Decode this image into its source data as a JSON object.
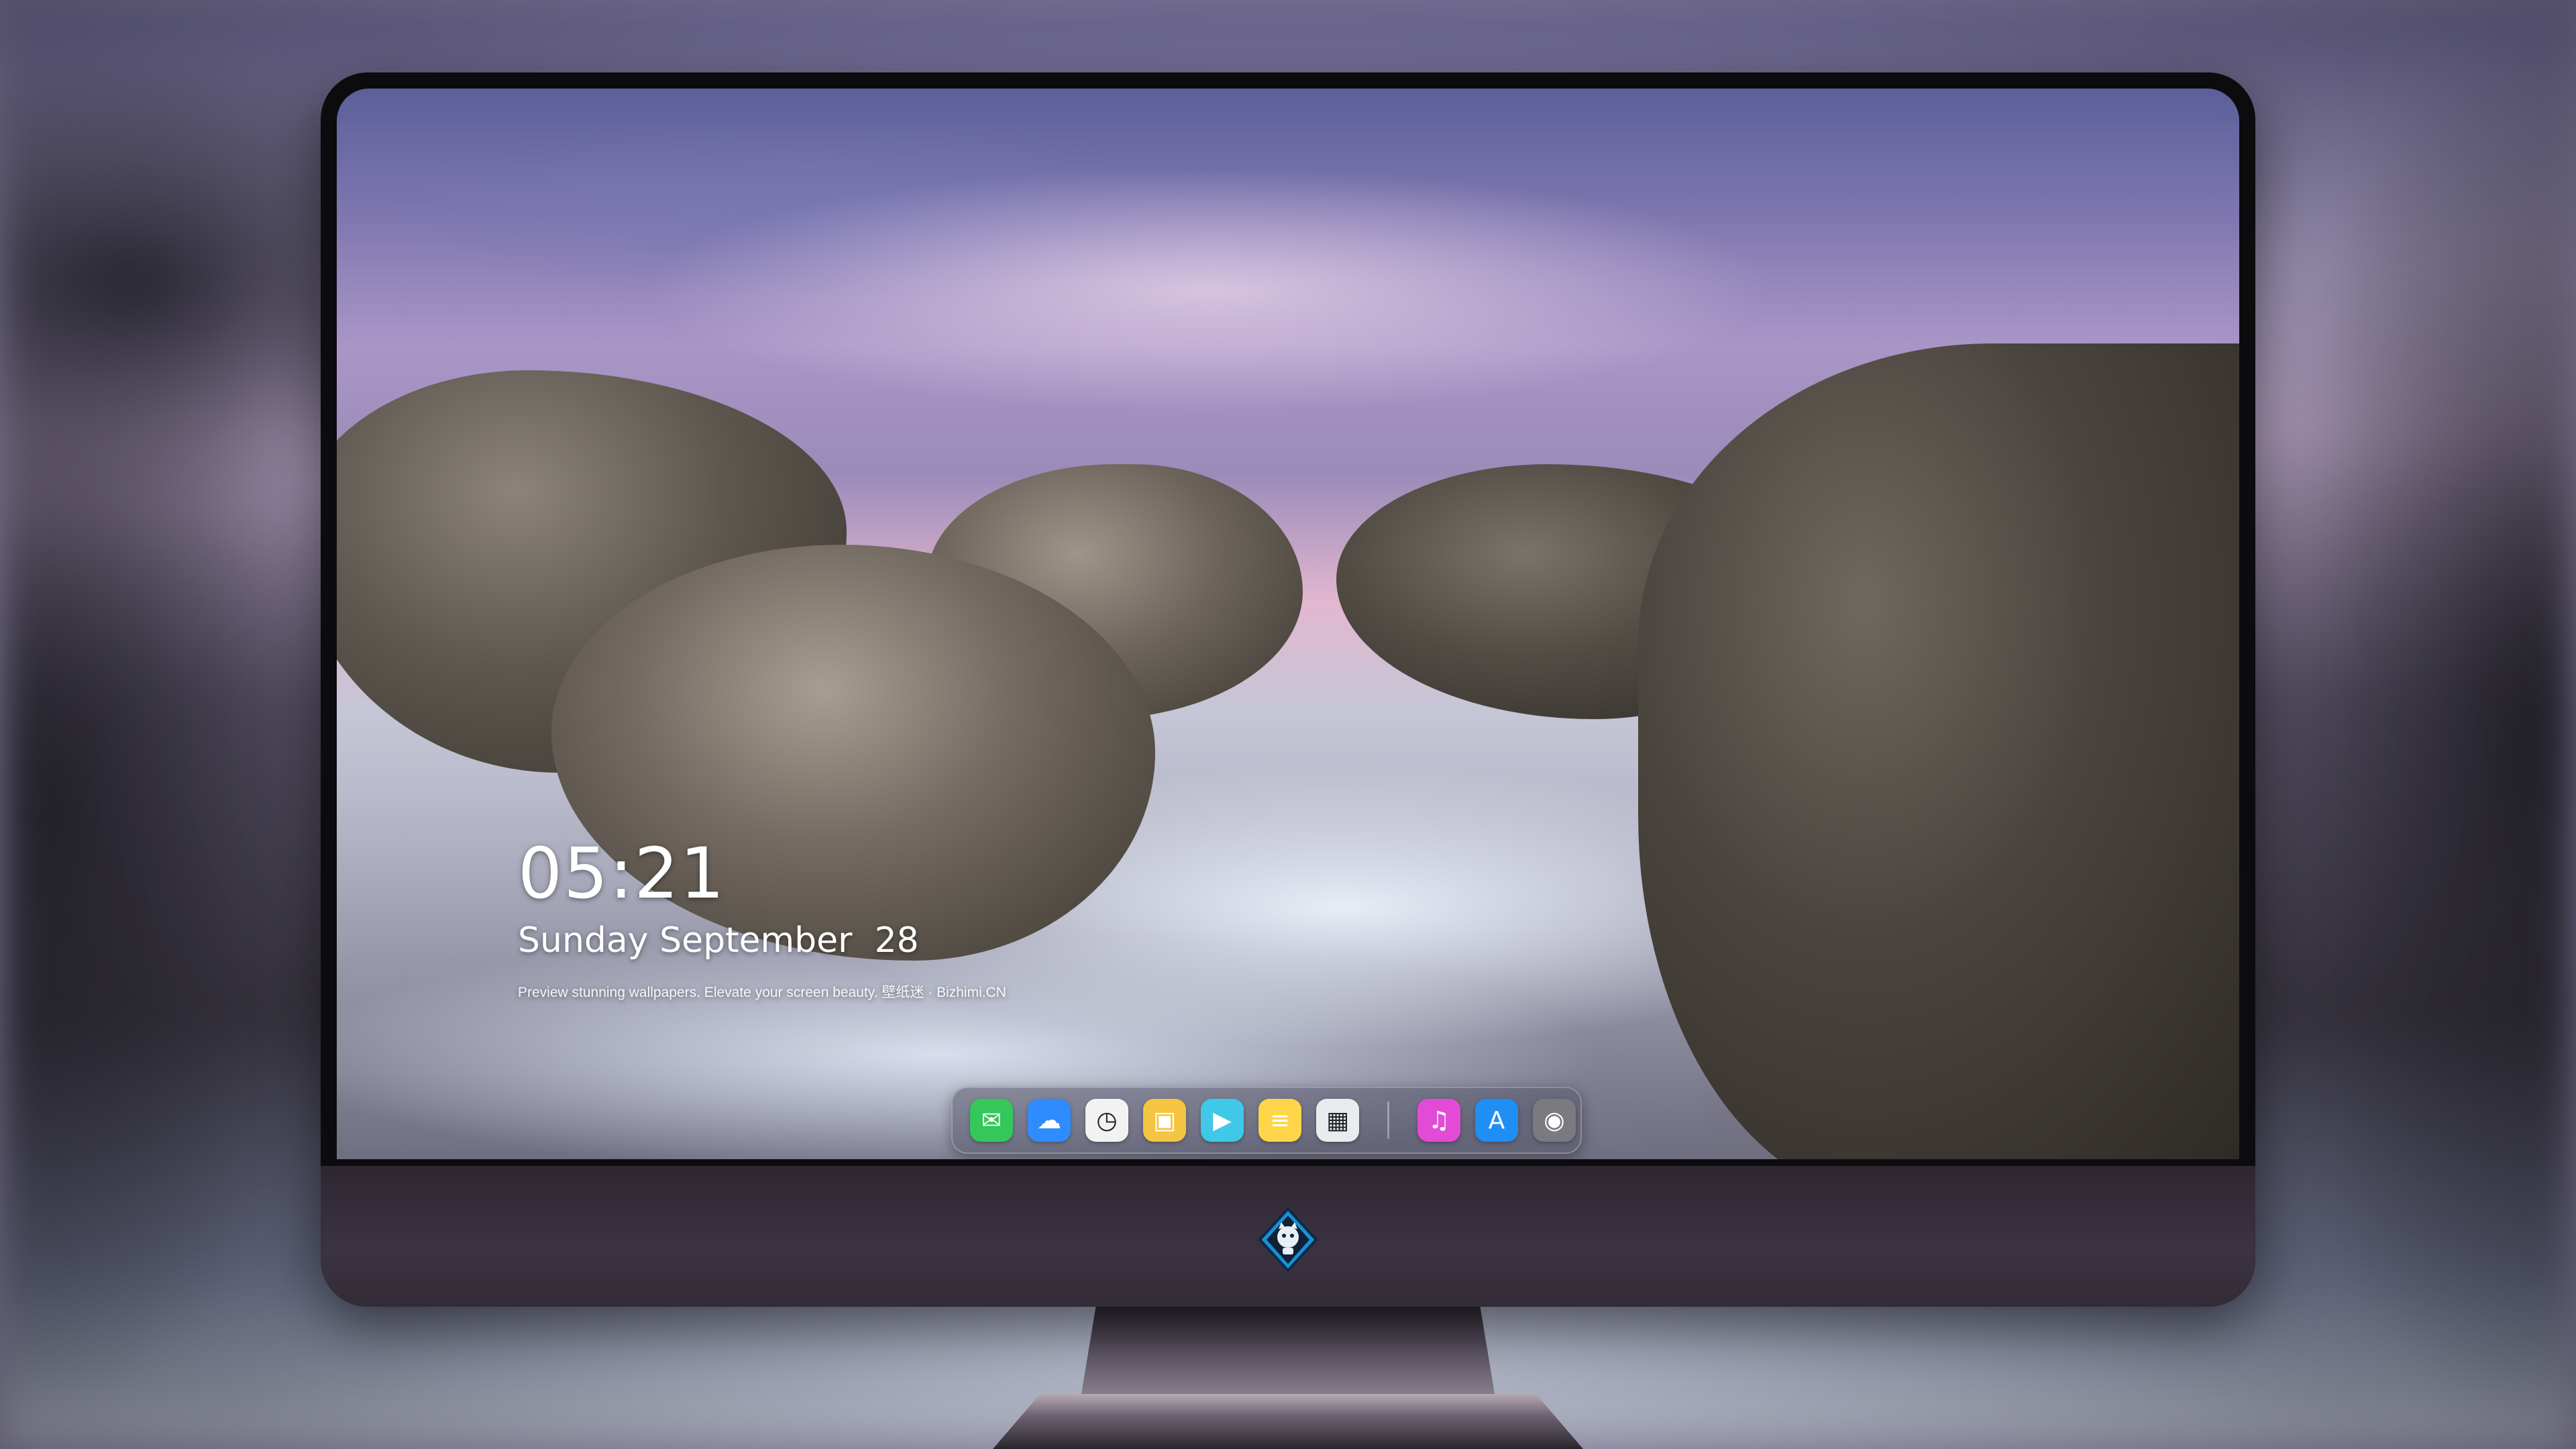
{
  "lockscreen": {
    "time": "05:21",
    "date": "Sunday September  28",
    "tagline": "Preview stunning wallpapers. Elevate your screen beauty. 壁纸迷 · Bizhimi.CN"
  },
  "dock": {
    "apps": [
      {
        "name": "messages-icon",
        "glyph": "✉",
        "color": "#34c759"
      },
      {
        "name": "weather-icon",
        "glyph": "☁",
        "color": "#2f8cff"
      },
      {
        "name": "clock-icon",
        "glyph": "◷",
        "color": "#f2f2f2"
      },
      {
        "name": "preview-icon",
        "glyph": "▣",
        "color": "#f4c542"
      },
      {
        "name": "clips-icon",
        "glyph": "▶",
        "color": "#40c8e8"
      },
      {
        "name": "notes-icon",
        "glyph": "≡",
        "color": "#ffd54a"
      },
      {
        "name": "photo-booth-icon",
        "glyph": "▦",
        "color": "#e9ecef"
      },
      {
        "name": "itunes-icon",
        "glyph": "♫",
        "color": "#e24bd6"
      },
      {
        "name": "app-store-icon",
        "glyph": "A",
        "color": "#1f8ef5"
      },
      {
        "name": "camera-icon",
        "glyph": "◉",
        "color": "#7a7a80"
      }
    ],
    "separator_after_index": 6
  }
}
